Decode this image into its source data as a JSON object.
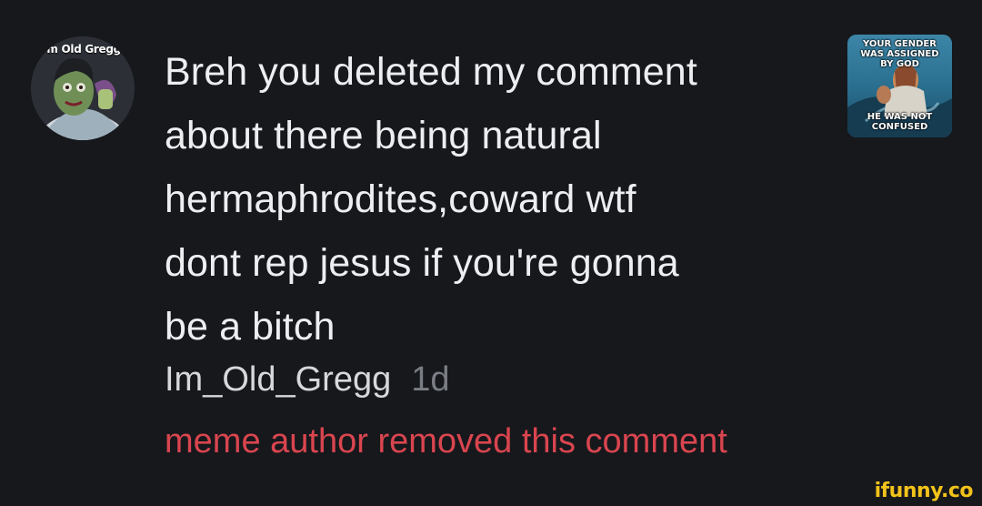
{
  "comment": {
    "avatar_caption": "I'm Old Gregg!",
    "lines": [
      "Breh you deleted my comment",
      "about there being natural",
      "hermaphrodites,coward wtf",
      "dont rep jesus if you're gonna",
      "be a bitch"
    ],
    "username": "Im_Old_Gregg",
    "time": "1d",
    "status": "meme author removed this comment"
  },
  "meme_thumbnail": {
    "top_text": "YOUR GENDER\nWAS ASSIGNED\nBY GOD",
    "bottom_text": "HE WAS NOT\nCONFUSED"
  },
  "watermark": "ifunny.co",
  "colors": {
    "background": "#16181c",
    "removed_text": "#d9454f",
    "watermark": "#f2c21a"
  }
}
